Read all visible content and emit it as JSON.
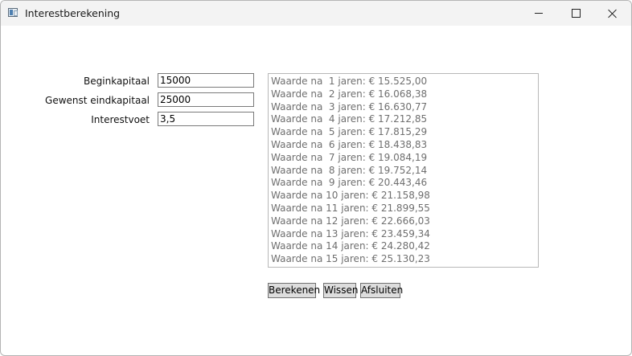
{
  "window": {
    "title": "Interestberekening"
  },
  "form": {
    "beginkapitaal_label": "Beginkapitaal",
    "beginkapitaal_value": "15000",
    "eindkapitaal_label": "Gewenst eindkapitaal",
    "eindkapitaal_value": "25000",
    "interestvoet_label": "Interestvoet",
    "interestvoet_value": "3,5"
  },
  "results": [
    "Waarde na  1 jaren: € 15.525,00",
    "Waarde na  2 jaren: € 16.068,38",
    "Waarde na  3 jaren: € 16.630,77",
    "Waarde na  4 jaren: € 17.212,85",
    "Waarde na  5 jaren: € 17.815,29",
    "Waarde na  6 jaren: € 18.438,83",
    "Waarde na  7 jaren: € 19.084,19",
    "Waarde na  8 jaren: € 19.752,14",
    "Waarde na  9 jaren: € 20.443,46",
    "Waarde na 10 jaren: € 21.158,98",
    "Waarde na 11 jaren: € 21.899,55",
    "Waarde na 12 jaren: € 22.666,03",
    "Waarde na 13 jaren: € 23.459,34",
    "Waarde na 14 jaren: € 24.280,42",
    "Waarde na 15 jaren: € 25.130,23"
  ],
  "buttons": {
    "berekenen": "Berekenen",
    "wissen": "Wissen",
    "afsluiten": "Afsluiten"
  }
}
